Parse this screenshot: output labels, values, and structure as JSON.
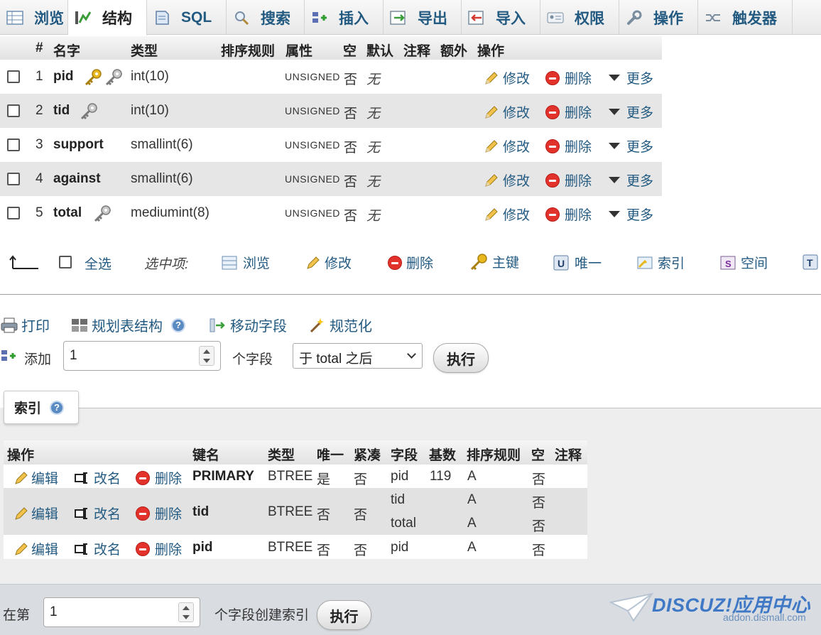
{
  "tabs": [
    {
      "label": "浏览",
      "icon": "browse-icon"
    },
    {
      "label": "结构",
      "icon": "structure-icon",
      "active": true
    },
    {
      "label": "SQL",
      "icon": "sql-icon"
    },
    {
      "label": "搜索",
      "icon": "search-icon"
    },
    {
      "label": "插入",
      "icon": "insert-icon"
    },
    {
      "label": "导出",
      "icon": "export-icon"
    },
    {
      "label": "导入",
      "icon": "import-icon"
    },
    {
      "label": "权限",
      "icon": "privileges-icon"
    },
    {
      "label": "操作",
      "icon": "operations-icon"
    },
    {
      "label": "触发器",
      "icon": "triggers-icon"
    }
  ],
  "structure": {
    "headers": {
      "num": "#",
      "name": "名字",
      "type": "类型",
      "collation": "排序规则",
      "attributes": "属性",
      "null": "空",
      "default": "默认",
      "comment": "注释",
      "extra": "额外",
      "action": "操作"
    },
    "rows": [
      {
        "num": "1",
        "name": "pid",
        "type": "int(10)",
        "attributes": "UNSIGNED",
        "null": "否",
        "default": "无",
        "keys": [
          "primary-key-icon",
          "index-key-icon"
        ]
      },
      {
        "num": "2",
        "name": "tid",
        "type": "int(10)",
        "attributes": "UNSIGNED",
        "null": "否",
        "default": "无",
        "keys": [
          "index-key-icon"
        ]
      },
      {
        "num": "3",
        "name": "support",
        "type": "smallint(6)",
        "attributes": "UNSIGNED",
        "null": "否",
        "default": "无",
        "keys": []
      },
      {
        "num": "4",
        "name": "against",
        "type": "smallint(6)",
        "attributes": "UNSIGNED",
        "null": "否",
        "default": "无",
        "keys": []
      },
      {
        "num": "5",
        "name": "total",
        "type": "mediumint(8)",
        "attributes": "UNSIGNED",
        "null": "否",
        "default": "无",
        "keys": [
          "index-key-icon"
        ]
      }
    ],
    "row_actions": {
      "edit": "修改",
      "drop": "删除",
      "more": "更多"
    }
  },
  "selection": {
    "check_all": "全选",
    "with_selected": "选中项:",
    "actions": [
      {
        "label": "浏览",
        "icon": "browse-icon"
      },
      {
        "label": "修改",
        "icon": "pencil-icon"
      },
      {
        "label": "删除",
        "icon": "delete-icon"
      },
      {
        "label": "主键",
        "icon": "primary-key-icon"
      },
      {
        "label": "唯一",
        "icon": "unique-icon"
      },
      {
        "label": "索引",
        "icon": "index-icon"
      },
      {
        "label": "空间",
        "icon": "spatial-icon"
      }
    ]
  },
  "tools": {
    "print": "打印",
    "propose_structure": "规划表结构",
    "move_columns": "移动字段",
    "normalize": "规范化"
  },
  "add_field": {
    "add_label": "添加",
    "count_value": "1",
    "fields_label": "个字段",
    "position_selected": "于 total 之后",
    "go": "执行"
  },
  "indexes": {
    "legend": "索引",
    "headers": {
      "action": "操作",
      "keyname": "键名",
      "type": "类型",
      "unique": "唯一",
      "packed": "紧凑",
      "column": "字段",
      "cardinality": "基数",
      "collation": "排序规则",
      "null": "空",
      "comment": "注释"
    },
    "action_labels": {
      "edit": "编辑",
      "rename": "改名",
      "drop": "删除"
    },
    "rows": [
      {
        "keyname": "PRIMARY",
        "type": "BTREE",
        "unique": "是",
        "packed": "否",
        "columns": [
          {
            "column": "pid",
            "cardinality": "119",
            "collation": "A",
            "null": "否"
          }
        ]
      },
      {
        "keyname": "tid",
        "type": "BTREE",
        "unique": "否",
        "packed": "否",
        "columns": [
          {
            "column": "tid",
            "cardinality": "",
            "collation": "A",
            "null": "否"
          },
          {
            "column": "total",
            "cardinality": "",
            "collation": "A",
            "null": "否"
          }
        ]
      },
      {
        "keyname": "pid",
        "type": "BTREE",
        "unique": "否",
        "packed": "否",
        "columns": [
          {
            "column": "pid",
            "cardinality": "",
            "collation": "A",
            "null": "否"
          }
        ]
      }
    ]
  },
  "footer": {
    "prefix": "在第",
    "count_value": "1",
    "suffix": "个字段创建索引",
    "go": "执行"
  },
  "watermark": {
    "brand": "DISCUZ!应用中心",
    "url": "addon.dismall.com"
  },
  "colors": {
    "link": "#235a81",
    "delete_red": "#e3322b",
    "key_gold": "#e8b820",
    "watermark_blue": "#3f78c4"
  }
}
